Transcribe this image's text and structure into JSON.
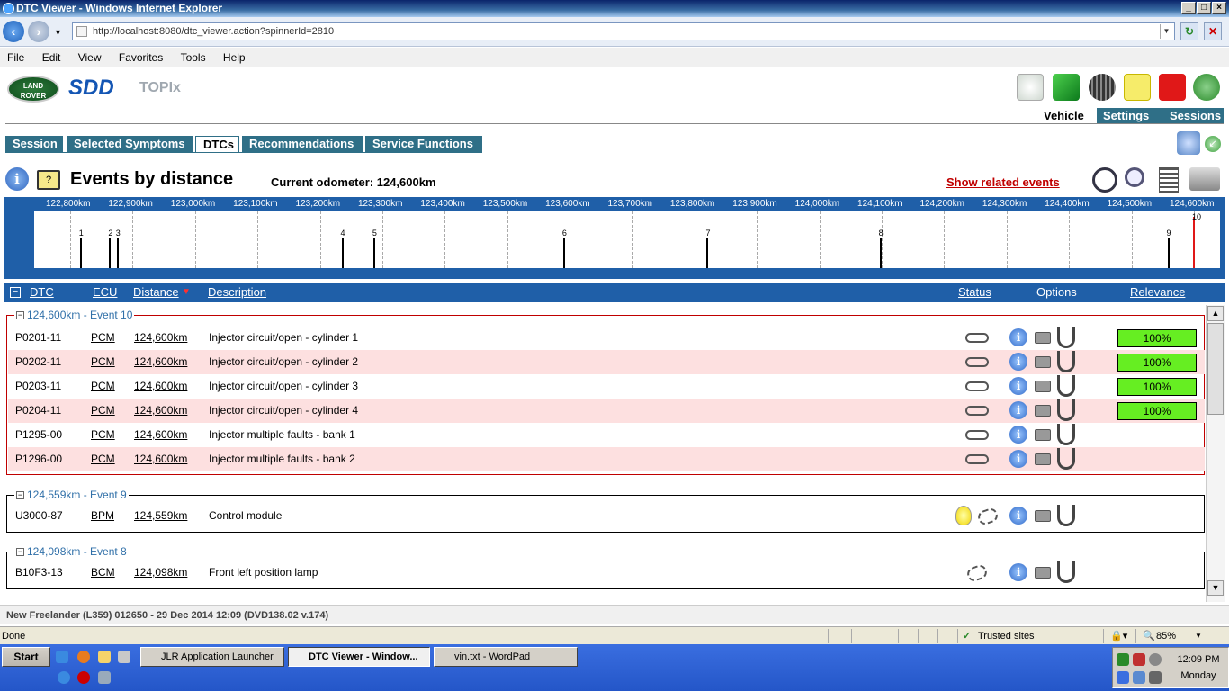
{
  "window": {
    "title": "DTC Viewer - Windows Internet Explorer"
  },
  "address": {
    "url": "http://localhost:8080/dtc_viewer.action?spinnerId=2810"
  },
  "menu": [
    "File",
    "Edit",
    "View",
    "Favorites",
    "Tools",
    "Help"
  ],
  "logos": {
    "lr_line1": "LAND",
    "lr_line2": "ROVER",
    "sdd": "SDD",
    "topix": "TOPIx"
  },
  "topnav": {
    "vehicle": "Vehicle",
    "settings": "Settings",
    "sessions": "Sessions"
  },
  "tabs": [
    {
      "label": "Session"
    },
    {
      "label": "Selected Symptoms"
    },
    {
      "label": "DTCs",
      "active": true
    },
    {
      "label": "Recommendations"
    },
    {
      "label": "Service Functions"
    }
  ],
  "page": {
    "title": "Events by distance",
    "odometer": "Current odometer: 124,600km",
    "show_related": "Show related events",
    "help_mark": "?"
  },
  "timeline": {
    "ticks": [
      "122,800km",
      "122,900km",
      "123,000km",
      "123,100km",
      "123,200km",
      "123,300km",
      "123,400km",
      "123,500km",
      "123,600km",
      "123,700km",
      "123,800km",
      "123,900km",
      "124,000km",
      "124,100km",
      "124,200km",
      "124,300km",
      "124,400km",
      "124,500km",
      "124,600km"
    ],
    "events": [
      {
        "num": "1",
        "km": 122817
      },
      {
        "num": "2",
        "km": 122864
      },
      {
        "num": "3",
        "km": 122876
      },
      {
        "num": "4",
        "km": 123236
      },
      {
        "num": "5",
        "km": 123287
      },
      {
        "num": "6",
        "km": 123591
      },
      {
        "num": "7",
        "km": 123821
      },
      {
        "num": "8",
        "km": 124098
      },
      {
        "num": "9",
        "km": 124559
      },
      {
        "num": "10",
        "km": 124600
      }
    ]
  },
  "table_header": {
    "dtc": "DTC",
    "ecu": "ECU",
    "distance": "Distance",
    "description": "Description",
    "status": "Status",
    "options": "Options",
    "relevance": "Relevance"
  },
  "groups": [
    {
      "label": "124,600km - Event 10",
      "rows": [
        {
          "dtc": "P0201-11",
          "ecu": "PCM",
          "distance": "124,600km",
          "description": "Injector circuit/open - cylinder 1",
          "relevance": "100%"
        },
        {
          "dtc": "P0202-11",
          "ecu": "PCM",
          "distance": "124,600km",
          "description": "Injector circuit/open - cylinder 2",
          "relevance": "100%"
        },
        {
          "dtc": "P0203-11",
          "ecu": "PCM",
          "distance": "124,600km",
          "description": "Injector circuit/open - cylinder 3",
          "relevance": "100%"
        },
        {
          "dtc": "P0204-11",
          "ecu": "PCM",
          "distance": "124,600km",
          "description": "Injector circuit/open - cylinder 4",
          "relevance": "100%"
        },
        {
          "dtc": "P1295-00",
          "ecu": "PCM",
          "distance": "124,600km",
          "description": "Injector multiple faults - bank 1",
          "relevance": ""
        },
        {
          "dtc": "P1296-00",
          "ecu": "PCM",
          "distance": "124,600km",
          "description": "Injector multiple faults - bank 2",
          "relevance": ""
        }
      ]
    },
    {
      "label": "124,559km - Event 9",
      "rows": [
        {
          "dtc": "U3000-87",
          "ecu": "BPM",
          "distance": "124,559km",
          "description": "Control module",
          "relevance": ""
        }
      ]
    },
    {
      "label": "124,098km - Event 8",
      "rows": [
        {
          "dtc": "B10F3-13",
          "ecu": "BCM",
          "distance": "124,098km",
          "description": "Front left position lamp",
          "relevance": ""
        }
      ]
    }
  ],
  "footer": {
    "vehicle_info": "New Freelander (L359) 012650 - 29 Dec 2014 12:09 (DVD138.02 v.174)"
  },
  "status": {
    "left": "Done",
    "zone": "Trusted sites",
    "zoom": "85%"
  },
  "taskbar": {
    "start": "Start",
    "items": [
      {
        "label": "JLR Application Launcher"
      },
      {
        "label": "DTC Viewer - Window..."
      },
      {
        "label": "vin.txt - WordPad"
      }
    ],
    "time": "12:09 PM",
    "day": "Monday"
  },
  "colors": {
    "accent_blue": "#1f5fa8",
    "tab_teal": "#2f6f87",
    "alert_red": "#c00000",
    "relevance_green": "#66ee22"
  }
}
